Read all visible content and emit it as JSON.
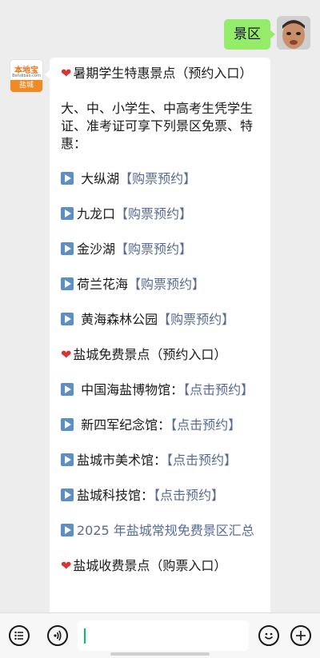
{
  "user_message": "景区",
  "bot": {
    "avatar_brand": "本地宝",
    "avatar_brand_sub": "Bendibao.com",
    "avatar_city": "盐城"
  },
  "message": {
    "section1_title": "暑期学生特惠景点（预约入口）",
    "intro": "大、中、小学生、中高考生凭学生证、准考证可享下列景区免票、特惠：",
    "items1": [
      {
        "name": " 大纵湖",
        "link": "【购票预约】"
      },
      {
        "name": "九龙口",
        "link": "【购票预约】"
      },
      {
        "name": "金沙湖",
        "link": "【购票预约】"
      },
      {
        "name": "荷兰花海",
        "link": "【购票预约】"
      },
      {
        "name": " 黄海森林公园",
        "link": "【购票预约】"
      }
    ],
    "section2_title": "盐城免费景点（预约入口）",
    "items2": [
      {
        "name": " 中国海盐博物馆：",
        "link": "【点击预约】"
      },
      {
        "name": " 新四军纪念馆：",
        "link": "【点击预约】"
      },
      {
        "name": "盐城市美术馆：",
        "link": "【点击预约】"
      },
      {
        "name": "盐城科技馆：",
        "link": "【点击预约】"
      }
    ],
    "summary_link": "2025 年盐城常规免费景区汇总",
    "section3_title": "盐城收费景点（购票入口）"
  },
  "icons": {
    "heart": "❤",
    "play": "play-square"
  },
  "colors": {
    "user_bubble": "#95ec69",
    "link": "#576b95",
    "heart": "#e0302d",
    "play_icon": "#5b8fc6",
    "caret": "#07c160",
    "brand_orange": "#f08a24"
  }
}
